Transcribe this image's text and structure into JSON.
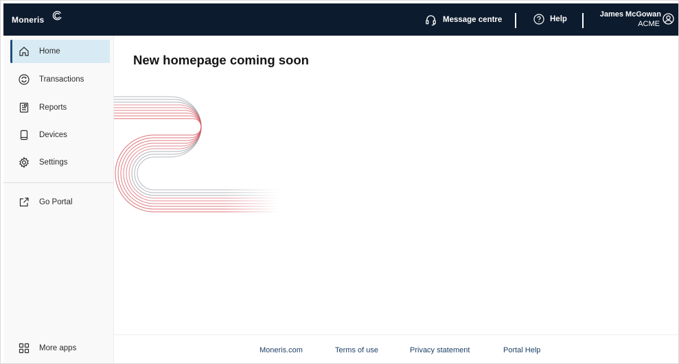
{
  "header": {
    "logo_text": "Moneris",
    "message_centre": "Message centre",
    "help": "Help",
    "user_name": "James McGowan",
    "company": "ACME"
  },
  "sidebar": {
    "items": [
      {
        "label": "Home",
        "icon": "home-icon",
        "active": true
      },
      {
        "label": "Transactions",
        "icon": "transactions-icon"
      },
      {
        "label": "Reports",
        "icon": "reports-icon"
      },
      {
        "label": "Devices",
        "icon": "devices-icon"
      },
      {
        "label": "Settings",
        "icon": "gear-icon"
      }
    ],
    "go_portal": {
      "label": "Go Portal",
      "icon": "external-link-icon"
    },
    "more_apps": {
      "label": "More apps",
      "icon": "apps-grid-icon"
    }
  },
  "main": {
    "title": "New homepage coming soon"
  },
  "footer": {
    "links": [
      "Moneris.com",
      "Terms of use",
      "Privacy statement",
      "Portal Help"
    ]
  },
  "colors": {
    "topbar": "#0d1b2e",
    "active_bg": "#d8ebf5",
    "accent_red": "#d0323c",
    "link": "#1c3f66"
  }
}
